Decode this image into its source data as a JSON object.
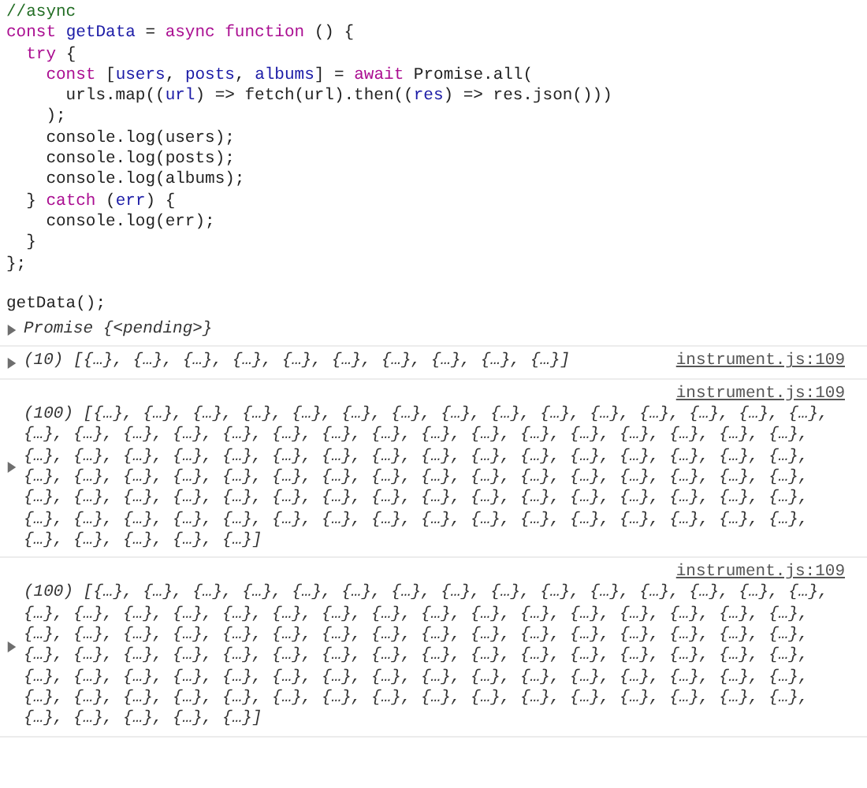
{
  "console": {
    "input_blocks": [
      {
        "lines": [
          [
            {
              "text": "//async",
              "kind": "comment"
            }
          ],
          [
            {
              "text": "const ",
              "kind": "keyword"
            },
            {
              "text": "getData",
              "kind": "definition"
            },
            {
              "text": " = ",
              "kind": "plain"
            },
            {
              "text": "async function",
              "kind": "keyword"
            },
            {
              "text": " () {",
              "kind": "plain"
            }
          ],
          [
            {
              "text": "  try",
              "kind": "keyword"
            },
            {
              "text": " {",
              "kind": "plain"
            }
          ],
          [
            {
              "text": "    const",
              "kind": "keyword"
            },
            {
              "text": " [",
              "kind": "plain"
            },
            {
              "text": "users",
              "kind": "definition"
            },
            {
              "text": ", ",
              "kind": "plain"
            },
            {
              "text": "posts",
              "kind": "definition"
            },
            {
              "text": ", ",
              "kind": "plain"
            },
            {
              "text": "albums",
              "kind": "definition"
            },
            {
              "text": "] = ",
              "kind": "plain"
            },
            {
              "text": "await",
              "kind": "keyword"
            },
            {
              "text": " Promise.all(",
              "kind": "plain"
            }
          ],
          [
            {
              "text": "      urls.map((",
              "kind": "plain"
            },
            {
              "text": "url",
              "kind": "definition"
            },
            {
              "text": ") => fetch(url).then((",
              "kind": "plain"
            },
            {
              "text": "res",
              "kind": "definition"
            },
            {
              "text": ") => res.json()))",
              "kind": "plain"
            }
          ],
          [
            {
              "text": "    );",
              "kind": "plain"
            }
          ],
          [
            {
              "text": "    console.log(users);",
              "kind": "plain"
            }
          ],
          [
            {
              "text": "    console.log(posts);",
              "kind": "plain"
            }
          ],
          [
            {
              "text": "    console.log(albums);",
              "kind": "plain"
            }
          ],
          [
            {
              "text": "  } ",
              "kind": "plain"
            },
            {
              "text": "catch",
              "kind": "keyword"
            },
            {
              "text": " (",
              "kind": "plain"
            },
            {
              "text": "err",
              "kind": "definition"
            },
            {
              "text": ") {",
              "kind": "plain"
            }
          ],
          [
            {
              "text": "    console.log(err);",
              "kind": "plain"
            }
          ],
          [
            {
              "text": "  }",
              "kind": "plain"
            }
          ],
          [
            {
              "text": "};",
              "kind": "plain"
            }
          ]
        ]
      },
      {
        "lines": [
          [
            {
              "text": "getData();",
              "kind": "plain"
            }
          ]
        ]
      }
    ],
    "entries": [
      {
        "kind": "result",
        "text": "Promise {<pending>}",
        "expanded": false
      },
      {
        "kind": "log",
        "text": "(10) [{…}, {…}, {…}, {…}, {…}, {…}, {…}, {…}, {…}, {…}]",
        "source": "instrument.js:109",
        "expanded": false
      },
      {
        "kind": "log",
        "text": "(100) [{…}, {…}, {…}, {…}, {…}, {…}, {…}, {…}, {…}, {…}, {…}, {…}, {…}, {…}, {…}, {…}, {…}, {…}, {…}, {…}, {…}, {…}, {…}, {…}, {…}, {…}, {…}, {…}, {…}, {…}, {…}, {…}, {…}, {…}, {…}, {…}, {…}, {…}, {…}, {…}, {…}, {…}, {…}, {…}, {…}, {…}, {…}, {…}, {…}, {…}, {…}, {…}, {…}, {…}, {…}, {…}, {…}, {…}, {…}, {…}, {…}, {…}, {…}, {…}, {…}, {…}, {…}, {…}, {…}, {…}, {…}, {…}, {…}, {…}, {…}, {…}, {…}, {…}, {…}, {…}, {…}, {…}, {…}, {…}, {…}, {…}, {…}, {…}, {…}, {…}, {…}, {…}, {…}, {…}, {…}, {…}, {…}, {…}, {…}, {…}]",
        "source": "instrument.js:109",
        "expanded": false
      },
      {
        "kind": "log",
        "text": "(100) [{…}, {…}, {…}, {…}, {…}, {…}, {…}, {…}, {…}, {…}, {…}, {…}, {…}, {…}, {…}, {…}, {…}, {…}, {…}, {…}, {…}, {…}, {…}, {…}, {…}, {…}, {…}, {…}, {…}, {…}, {…}, {…}, {…}, {…}, {…}, {…}, {…}, {…}, {…}, {…}, {…}, {…}, {…}, {…}, {…}, {…}, {…}, {…}, {…}, {…}, {…}, {…}, {…}, {…}, {…}, {…}, {…}, {…}, {…}, {…}, {…}, {…}, {…}, {…}, {…}, {…}, {…}, {…}, {…}, {…}, {…}, {…}, {…}, {…}, {…}, {…}, {…}, {…}, {…}, {…}, {…}, {…}, {…}, {…}, {…}, {…}, {…}, {…}, {…}, {…}, {…}, {…}, {…}, {…}, {…}, {…}, {…}, {…}, {…}, {…}]",
        "source": "instrument.js:109",
        "expanded": false
      }
    ]
  }
}
